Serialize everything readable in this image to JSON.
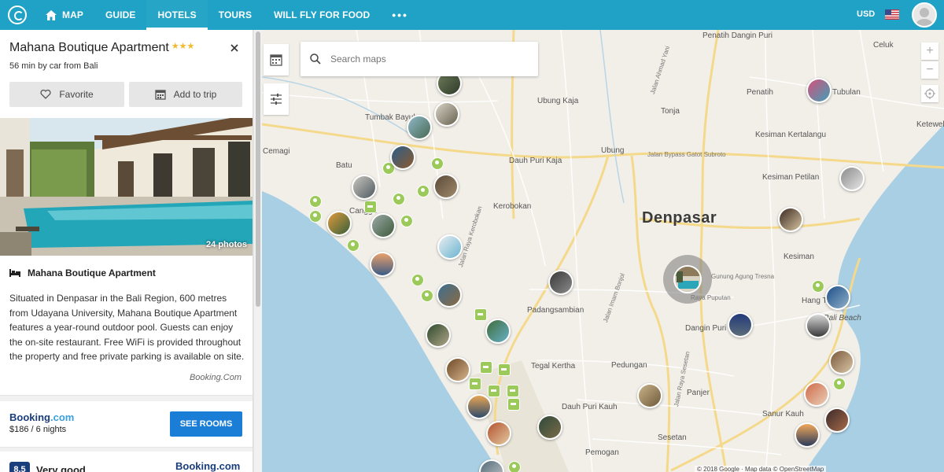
{
  "nav": {
    "items": [
      {
        "label": "MAP",
        "icon": "home-icon"
      },
      {
        "label": "GUIDE"
      },
      {
        "label": "HOTELS",
        "active": true
      },
      {
        "label": "TOURS"
      },
      {
        "label": "WILL FLY FOR FOOD"
      },
      {
        "label": "•••"
      }
    ],
    "currency": "USD",
    "accent": "#1fa2c5"
  },
  "hotel": {
    "name": "Mahana Boutique Apartment",
    "stars": "★★★",
    "travel_time": "56 min by car from Bali",
    "favorite_label": "Favorite",
    "add_trip_label": "Add to trip",
    "photo_count": "24 photos",
    "property_name": "Mahana Boutique Apartment",
    "description": "Situated in Denpasar in the Bali Region, 600 metres from Udayana University, Mahana Boutique Apartment features a year-round outdoor pool. Guests can enjoy the on-site restaurant. Free WiFi is provided throughout the property and free private parking is available on site.",
    "source": "Booking.Com"
  },
  "offer": {
    "provider_main": "Booking",
    "provider_tld": ".com",
    "price": "$186 / 6 nights",
    "cta": "SEE ROOMS",
    "cta_color": "#1b7ed6"
  },
  "review": {
    "score": "8.5",
    "label": "Very good",
    "provider": "Booking.com"
  },
  "map": {
    "search_placeholder": "Search maps",
    "attribution": "© 2018 Google · Map data © OpenStreetMap",
    "labels": {
      "penatih_dangin_puri": "Penatih Dangin Puri",
      "celuk": "Celuk",
      "ubung_kaja": "Ubung Kaja",
      "penatih": "Penatih",
      "tubulan": "Tubulan",
      "tumbak_bayuh": "Tumbak Bayuh",
      "tonja": "Tonja",
      "ketewel": "Ketewel",
      "cemagi": "Cemagi",
      "ubung": "Ubung",
      "kesiman_kertalangu": "Kesiman Kertalangu",
      "batu": "Batu",
      "dauh_puri_kaja": "Dauh Puri Kaja",
      "kesiman_petilan": "Kesiman Petilan",
      "canggu": "Canggu",
      "kerobokan": "Kerobokan",
      "denpasar": "Denpasar",
      "kesiman": "Kesiman",
      "padangsambian": "Padangsambian",
      "raya_puputan": "Raya Puputan",
      "hang_tuah": "Hang Tuah",
      "bali_beach": "Bali Beach",
      "dangin_puri": "Dangin Puri",
      "tegal_kertha": "Tegal Kertha",
      "pedungan": "Pedungan",
      "panjer": "Panjer",
      "dauh_puri_kauh": "Dauh Puri Kauh",
      "sanur_kauh": "Sanur Kauh",
      "sesetan": "Sesetan",
      "pemogan": "Pemogan",
      "bypass": "Jalan Bypass Gatot Subroto",
      "raya_kerobokan": "Jalan Raya Kerobokan",
      "imam_bonjol": "Jalan Imam Bonjol",
      "raya_sesetan": "Jalan Raya Sesetan",
      "ahmad_yani": "Jalan Ahmad Yani",
      "gunung_agung_tresna": "Gunung Agung Tresna"
    }
  }
}
